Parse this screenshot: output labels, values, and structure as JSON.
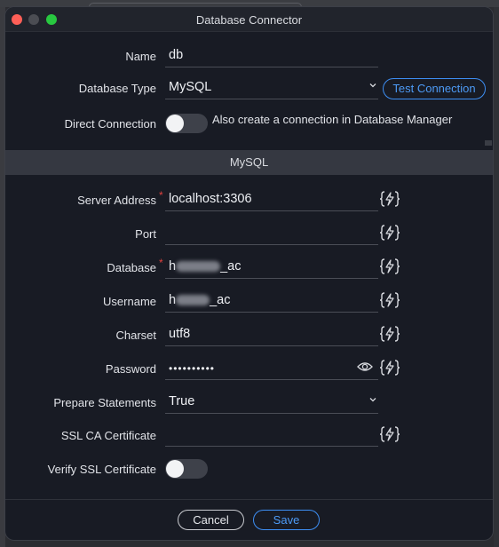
{
  "window": {
    "title": "Database Connector"
  },
  "general": {
    "name_label": "Name",
    "name_value": "db",
    "db_type_label": "Database Type",
    "db_type_value": "MySQL",
    "test_connection_label": "Test Connection",
    "direct_connection_label": "Direct Connection",
    "direct_connection_text": "Also create a connection in Database Manager",
    "direct_connection_on": false
  },
  "section_title": "MySQL",
  "mysql": {
    "server_address_label": "Server Address",
    "server_address_value": "localhost:3306",
    "port_label": "Port",
    "port_value": "",
    "database_label": "Database",
    "database_prefix": "h",
    "database_suffix": "_ac",
    "username_label": "Username",
    "username_prefix": "h",
    "username_suffix": "_ac",
    "charset_label": "Charset",
    "charset_value": "utf8",
    "password_label": "Password",
    "password_value": "••••••••••",
    "prepare_statements_label": "Prepare Statements",
    "prepare_statements_value": "True",
    "ssl_ca_label": "SSL CA Certificate",
    "ssl_ca_value": "",
    "verify_ssl_label": "Verify SSL Certificate",
    "verify_ssl_on": false
  },
  "footer": {
    "cancel_label": "Cancel",
    "save_label": "Save"
  },
  "required_marker": "*",
  "icons": {
    "variable": "variable-bolt-icon",
    "eye": "eye-icon",
    "chevron": "chevron-down-icon"
  },
  "colors": {
    "accent": "#3d8ef3",
    "required": "#e0413e",
    "close": "#fe5f57",
    "maximize": "#28c840"
  }
}
